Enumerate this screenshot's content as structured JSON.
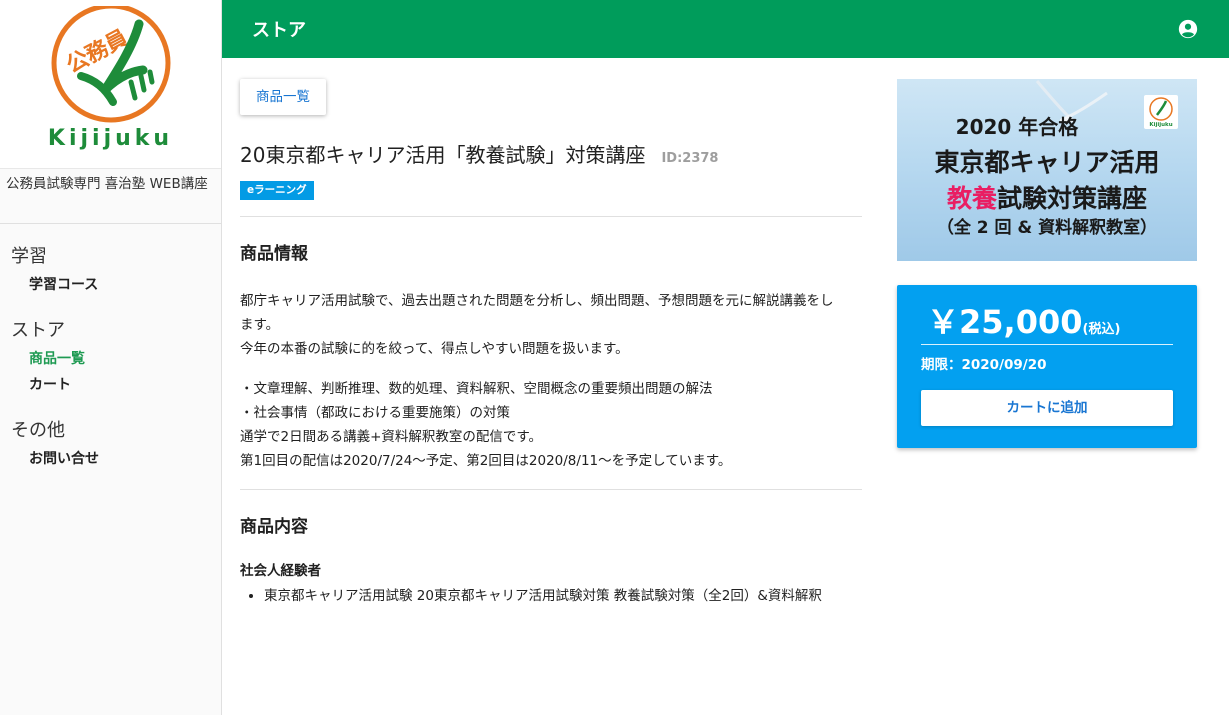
{
  "sidebar": {
    "logo_text": "公務員",
    "logo_word": "Kijijuku",
    "site_name": "公務員試験専門 喜治塾 WEB講座",
    "sections": [
      {
        "heading": "学習",
        "items": [
          {
            "label": "学習コース"
          }
        ]
      },
      {
        "heading": "ストア",
        "items": [
          {
            "label": "商品一覧"
          },
          {
            "label": "カート"
          }
        ]
      },
      {
        "heading": "その他",
        "items": [
          {
            "label": "お問い合せ"
          }
        ]
      }
    ]
  },
  "header": {
    "title": "ストア"
  },
  "main": {
    "back_button": "商品一覧",
    "title": "20東京都キャリア活用「教養試験」対策講座",
    "id_label": "ID:2378",
    "badge": "eラーニング",
    "info_heading": "商品情報",
    "desc_block1": [
      "都庁キャリア活用試験で、過去出題された問題を分析し、頻出問題、予想問題を元に解説講義をし",
      "ます。",
      "今年の本番の試験に的を絞って、得点しやすい問題を扱います。"
    ],
    "desc_block2": [
      "・文章理解、判断推理、数的処理、資料解釈、空間概念の重要頻出問題の解法",
      "・社会事情（都政における重要施策）の対策",
      "通学で2日間ある講義+資料解釈教室の配信です。",
      "第1回目の配信は2020/7/24〜予定、第2回目は2020/8/11〜を予定しています。"
    ],
    "contents_heading": "商品内容",
    "contents_subtitle": "社会人経験者",
    "contents_items": [
      "東京都キャリア活用試験 20東京都キャリア活用試験対策 教養試験対策（全2回）&資料解釈"
    ]
  },
  "banner": {
    "line1": "2020 年合格",
    "line2": "東京都キャリア活用",
    "line3_accent": "教養",
    "line3_rest": "試験対策講座",
    "line4": "（全 2 回 & 資料解釈教室）",
    "logo_word": "Kijijuku"
  },
  "price_card": {
    "price": "￥25,000",
    "tax": "(税込)",
    "deadline": "期限：2020/09/20",
    "cart_button": "カートに追加"
  },
  "colors": {
    "header": "#009c5b",
    "active_nav": "#1e9a52",
    "price_card": "#03a0f0",
    "badge": "#039be5",
    "link": "#1976d2",
    "logo_orange": "#e87722",
    "logo_green": "#1e8c3a"
  }
}
